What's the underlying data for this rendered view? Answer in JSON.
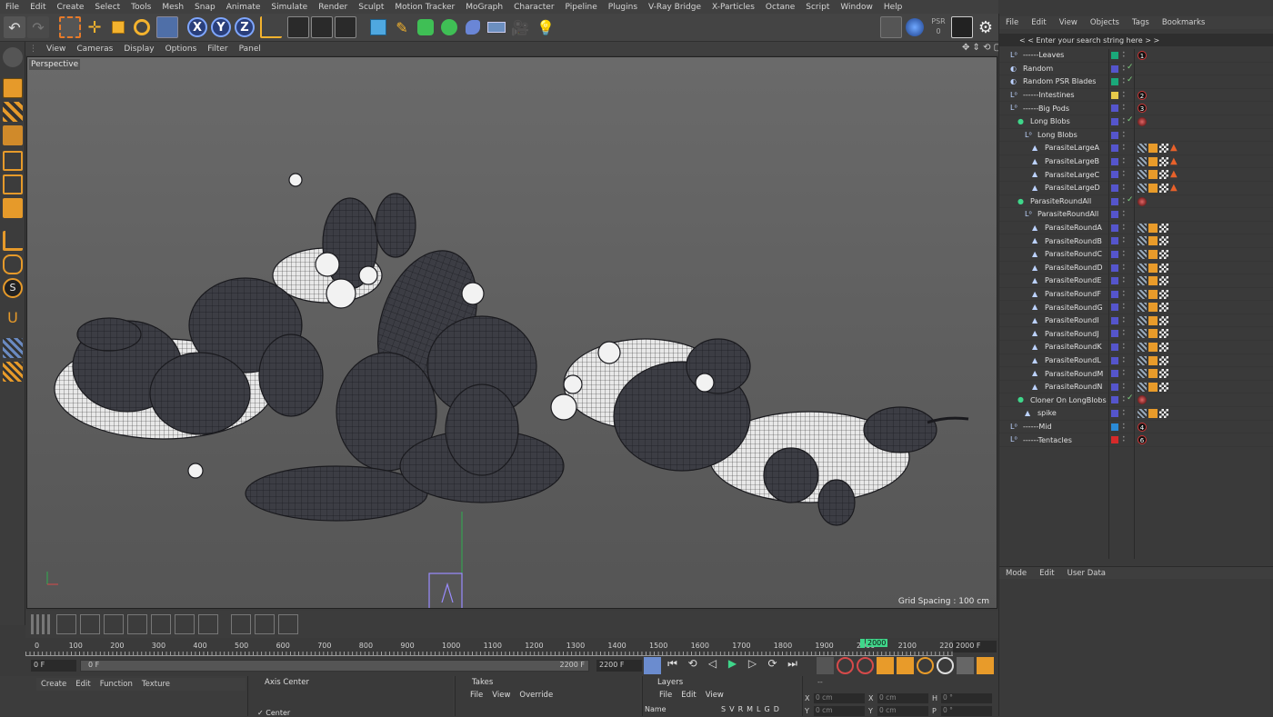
{
  "menubar": [
    "File",
    "Edit",
    "Create",
    "Select",
    "Tools",
    "Mesh",
    "Snap",
    "Animate",
    "Simulate",
    "Render",
    "Sculpt",
    "Motion Tracker",
    "MoGraph",
    "Character",
    "Pipeline",
    "Plugins",
    "V-Ray Bridge",
    "X-Particles",
    "Octane",
    "Script",
    "Window",
    "Help"
  ],
  "viewport_menu": [
    "View",
    "Cameras",
    "Display",
    "Options",
    "Filter",
    "Panel"
  ],
  "viewport": {
    "label": "Perspective",
    "grid_spacing": "Grid Spacing : 100 cm"
  },
  "toolbar": {
    "axis_x": "X",
    "axis_y": "Y",
    "axis_z": "Z",
    "psr_label": "PSR",
    "psr_value": "0"
  },
  "object_manager": {
    "tabs": [
      "File",
      "Edit",
      "View",
      "Objects",
      "Tags",
      "Bookmarks"
    ],
    "search_placeholder": "< < Enter your search string here > >",
    "objects": [
      {
        "name": "------Leaves",
        "indent": 0,
        "color": "#1aa87a",
        "tag_num": "1",
        "kind": "null"
      },
      {
        "name": "Random",
        "indent": 0,
        "color": "#5555cc",
        "check": true,
        "kind": "effector"
      },
      {
        "name": "Random PSR Blades",
        "indent": 0,
        "color": "#1aa87a",
        "check": true,
        "kind": "effector"
      },
      {
        "name": "------Intestines",
        "indent": 0,
        "color": "#e6c94a",
        "tag_num": "2",
        "kind": "null"
      },
      {
        "name": "------Big Pods",
        "indent": 0,
        "color": "#5555cc",
        "tag_num": "3",
        "kind": "null"
      },
      {
        "name": "Long Blobs",
        "indent": 1,
        "color": "#5555cc",
        "check": true,
        "kind": "cloner",
        "tag_ball": true
      },
      {
        "name": "Long Blobs",
        "indent": 2,
        "color": "#5555cc",
        "kind": "null"
      },
      {
        "name": "ParasiteLargeA",
        "indent": 3,
        "color": "#5555cc",
        "kind": "poly",
        "tag_tri": true
      },
      {
        "name": "ParasiteLargeB",
        "indent": 3,
        "color": "#5555cc",
        "kind": "poly",
        "tag_tri": true
      },
      {
        "name": "ParasiteLargeC",
        "indent": 3,
        "color": "#5555cc",
        "kind": "poly",
        "tag_tri": true
      },
      {
        "name": "ParasiteLargeD",
        "indent": 3,
        "color": "#5555cc",
        "kind": "poly",
        "tag_tri": true
      },
      {
        "name": "ParasiteRoundAll",
        "indent": 1,
        "color": "#5555cc",
        "check": true,
        "kind": "cloner",
        "tag_ball": true
      },
      {
        "name": "ParasiteRoundAll",
        "indent": 2,
        "color": "#5555cc",
        "kind": "null"
      },
      {
        "name": "ParasiteRoundA",
        "indent": 3,
        "color": "#5555cc",
        "kind": "poly"
      },
      {
        "name": "ParasiteRoundB",
        "indent": 3,
        "color": "#5555cc",
        "kind": "poly"
      },
      {
        "name": "ParasiteRoundC",
        "indent": 3,
        "color": "#5555cc",
        "kind": "poly"
      },
      {
        "name": "ParasiteRoundD",
        "indent": 3,
        "color": "#5555cc",
        "kind": "poly"
      },
      {
        "name": "ParasiteRoundE",
        "indent": 3,
        "color": "#5555cc",
        "kind": "poly"
      },
      {
        "name": "ParasiteRoundF",
        "indent": 3,
        "color": "#5555cc",
        "kind": "poly"
      },
      {
        "name": "ParasiteRoundG",
        "indent": 3,
        "color": "#5555cc",
        "kind": "poly"
      },
      {
        "name": "ParasiteRoundI",
        "indent": 3,
        "color": "#5555cc",
        "kind": "poly"
      },
      {
        "name": "ParasiteRoundJ",
        "indent": 3,
        "color": "#5555cc",
        "kind": "poly"
      },
      {
        "name": "ParasiteRoundK",
        "indent": 3,
        "color": "#5555cc",
        "kind": "poly"
      },
      {
        "name": "ParasiteRoundL",
        "indent": 3,
        "color": "#5555cc",
        "kind": "poly"
      },
      {
        "name": "ParasiteRoundM",
        "indent": 3,
        "color": "#5555cc",
        "kind": "poly"
      },
      {
        "name": "ParasiteRoundN",
        "indent": 3,
        "color": "#5555cc",
        "kind": "poly"
      },
      {
        "name": "Cloner On LongBlobs",
        "indent": 1,
        "color": "#5555cc",
        "check": true,
        "kind": "cloner",
        "tag_ball": true
      },
      {
        "name": "spike",
        "indent": 2,
        "color": "#5555cc",
        "kind": "poly"
      },
      {
        "name": "------Mid",
        "indent": 0,
        "color": "#2a8ad6",
        "tag_num": "4",
        "kind": "null"
      },
      {
        "name": "------Tentacles",
        "indent": 0,
        "color": "#d62a2a",
        "tag_num": "6",
        "kind": "null"
      }
    ]
  },
  "attribute_manager": {
    "tabs": [
      "Mode",
      "Edit",
      "User Data"
    ]
  },
  "timeline": {
    "ticks": [
      "0",
      "100",
      "200",
      "300",
      "400",
      "500",
      "600",
      "700",
      "800",
      "900",
      "1000",
      "1100",
      "1200",
      "1300",
      "1400",
      "1500",
      "1600",
      "1700",
      "1800",
      "1900",
      "2000",
      "2100",
      "220"
    ],
    "current_frame": "2000",
    "end_field": "2000 F",
    "start_field": "0 F",
    "range_start": "0 F",
    "range_end_inner": "2200 F",
    "range_end": "2200 F"
  },
  "bottom": {
    "material_tabs": [
      "Create",
      "Edit",
      "Function",
      "Texture"
    ],
    "axis_center_title": "Axis Center",
    "axis_center_option": "Center",
    "takes_title": "Takes",
    "takes_tabs": [
      "File",
      "View",
      "Override"
    ],
    "layers_title": "Layers",
    "layers_tabs": [
      "File",
      "Edit",
      "View"
    ],
    "layers_col_name": "Name",
    "layers_cols": [
      "S",
      "V",
      "R",
      "M",
      "L",
      "G",
      "D"
    ],
    "coords_header": "--",
    "coords": [
      {
        "axis": "X",
        "pos": "0 cm",
        "axis2": "X",
        "pos2": "0 cm",
        "axis3": "H",
        "rot": "0 °"
      },
      {
        "axis": "Y",
        "pos": "0 cm",
        "axis2": "Y",
        "pos2": "0 cm",
        "axis3": "P",
        "rot": "0 °"
      }
    ]
  },
  "colors": {
    "accent_blue": "#7fa7ff",
    "orange": "#e89b2a",
    "active_green": "#3fd68a"
  }
}
